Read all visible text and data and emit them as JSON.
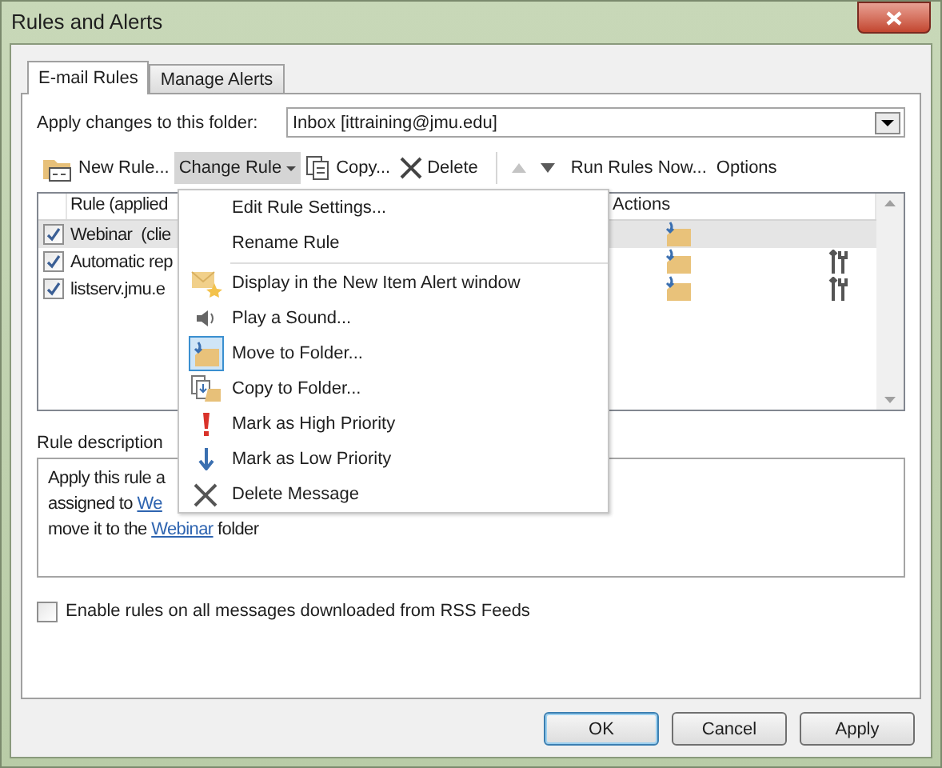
{
  "window": {
    "title": "Rules and Alerts"
  },
  "tabs": [
    {
      "label": "E-mail Rules",
      "selected": true
    },
    {
      "label": "Manage Alerts",
      "selected": false
    }
  ],
  "folder": {
    "label": "Apply changes to this folder:",
    "value": "Inbox [ittraining@jmu.edu]"
  },
  "toolbar": [
    {
      "kind": "new",
      "label": "New Rule...",
      "selected": false
    },
    {
      "kind": "change",
      "label": "Change Rule",
      "selected": true
    },
    {
      "kind": "copy",
      "label": "Copy...",
      "selected": false
    },
    {
      "kind": "delete",
      "label": "Delete",
      "selected": false
    },
    {
      "kind": "up",
      "disabled": true
    },
    {
      "kind": "down",
      "disabled": false
    },
    {
      "kind": "text",
      "label": "Run Rules Now...",
      "selected": false
    },
    {
      "kind": "text",
      "label": "Options",
      "selected": false
    }
  ],
  "rules_table": {
    "columns": [
      "Rule (applied",
      "Actions"
    ],
    "rows": [
      {
        "name": "Webinar  (clie",
        "checked": true,
        "selected": true,
        "tools": false
      },
      {
        "name": "Automatic rep",
        "checked": true,
        "selected": false,
        "tools": true
      },
      {
        "name": "listserv.jmu.e",
        "checked": true,
        "selected": false,
        "tools": true
      }
    ]
  },
  "rule_description": {
    "label": "Rule description",
    "lines": [
      [
        {
          "text": "Apply this rule a"
        }
      ],
      [
        {
          "text": "assigned to "
        },
        {
          "text": "We",
          "link": true
        }
      ],
      [
        {
          "text": "move it to the "
        },
        {
          "text": "Webinar",
          "link": true
        },
        {
          "text": " folder"
        }
      ]
    ]
  },
  "rss_checkbox": {
    "label": "Enable rules on all messages downloaded from RSS Feeds",
    "checked": false
  },
  "buttons": [
    {
      "label": "OK",
      "default": true
    },
    {
      "label": "Cancel",
      "default": false
    },
    {
      "label": "Apply",
      "default": false
    }
  ],
  "menu": [
    {
      "kind": "edit",
      "label": "Edit Rule Settings..."
    },
    {
      "kind": "rename",
      "label": "Rename Rule"
    },
    {
      "kind": "separator"
    },
    {
      "kind": "alert",
      "label": "Display in the New Item Alert window"
    },
    {
      "kind": "sound",
      "label": "Play a Sound..."
    },
    {
      "kind": "move",
      "label": "Move to Folder..."
    },
    {
      "kind": "copyfolder",
      "label": "Copy to Folder..."
    },
    {
      "kind": "high",
      "label": "Mark as High Priority"
    },
    {
      "kind": "low",
      "label": "Mark as Low Priority"
    },
    {
      "kind": "deletemsg",
      "label": "Delete Message"
    }
  ]
}
